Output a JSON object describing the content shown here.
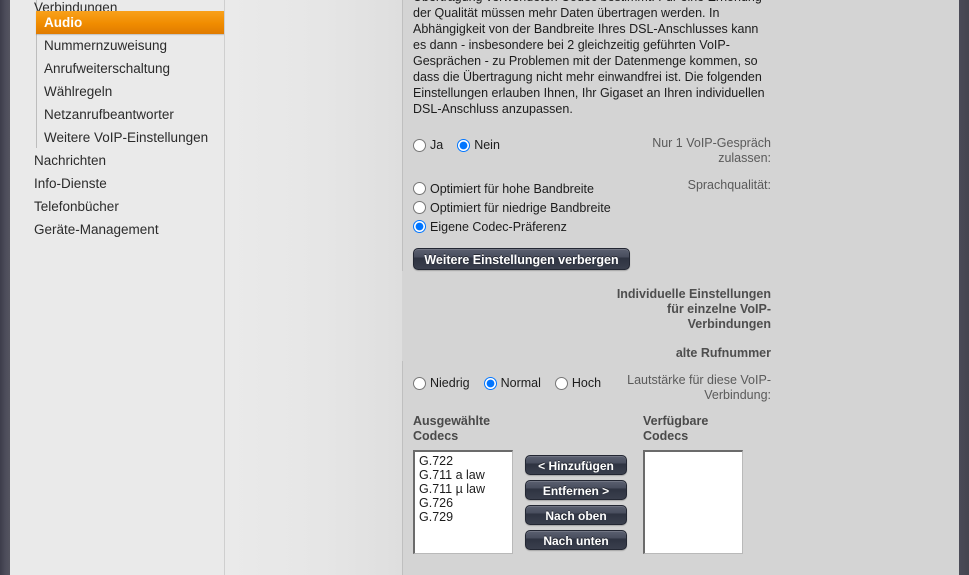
{
  "sidebar": {
    "items": [
      {
        "label": "Verbindungen",
        "level": 1,
        "state": "clipped"
      },
      {
        "label": "Audio",
        "level": 2,
        "state": "active"
      },
      {
        "label": "Nummernzuweisung",
        "level": 2,
        "state": "normal"
      },
      {
        "label": "Anrufweiterschaltung",
        "level": 2,
        "state": "normal"
      },
      {
        "label": "Wählregeln",
        "level": 2,
        "state": "normal"
      },
      {
        "label": "Netzanrufbeantworter",
        "level": 2,
        "state": "normal"
      },
      {
        "label": "Weitere VoIP-Einstellungen",
        "level": 2,
        "state": "normal"
      },
      {
        "label": "Nachrichten",
        "level": 1,
        "state": "normal"
      },
      {
        "label": "Info-Dienste",
        "level": 1,
        "state": "normal"
      },
      {
        "label": "Telefonbücher",
        "level": 1,
        "state": "normal"
      },
      {
        "label": "Geräte-Management",
        "level": 1,
        "state": "normal"
      }
    ]
  },
  "main": {
    "intro_paragraph": "Übertragung verwendeten Codec bestimmt. Für eine Erhöhung der Qualität müssen mehr Daten übertragen werden. In Abhängigkeit von der Bandbreite Ihres DSL-Anschlusses kann es dann - insbesondere bei 2 gleichzeitig geführten VoIP-Gesprächen - zu Problemen mit der Datenmenge kommen, so dass die Übertragung nicht mehr einwandfrei ist. Die folgenden Einstellungen erlauben Ihnen, Ihr Gigaset an Ihren individuellen DSL-Anschluss anzupassen.",
    "single_call": {
      "label_line1": "Nur 1 VoIP-Gespräch",
      "label_line2": "zulassen:",
      "options": [
        {
          "label": "Ja",
          "checked": false
        },
        {
          "label": "Nein",
          "checked": true
        }
      ]
    },
    "voice_quality": {
      "label": "Sprachqualität:",
      "options": [
        {
          "label": "Optimiert für hohe Bandbreite",
          "checked": false
        },
        {
          "label": "Optimiert für niedrige Bandbreite",
          "checked": false
        },
        {
          "label": "Eigene Codec-Präferenz",
          "checked": true
        }
      ],
      "toggle_button": "Weitere Einstellungen verbergen"
    },
    "individual_settings": {
      "label_line1": "Individuelle Einstellungen",
      "label_line2": "für einzelne VoIP-",
      "label_line3": "Verbindungen"
    },
    "old_number": {
      "label": "alte Rufnummer",
      "value": ""
    },
    "volume": {
      "label_line1": "Lautstärke für diese VoIP-",
      "label_line2": "Verbindung:",
      "options": [
        {
          "label": "Niedrig",
          "checked": false
        },
        {
          "label": "Normal",
          "checked": true
        },
        {
          "label": "Hoch",
          "checked": false
        }
      ]
    },
    "codecs": {
      "selected_heading_line1": "Ausgewählte",
      "selected_heading_line2": "Codecs",
      "available_heading_line1": "Verfügbare",
      "available_heading_line2": "Codecs",
      "selected_list": [
        "G.722",
        "G.711 a law",
        "G.711 µ law",
        "G.726",
        "G.729"
      ],
      "available_list": [],
      "buttons": [
        "< Hinzufügen",
        "Entfernen >",
        "Nach oben",
        "Nach unten"
      ]
    }
  },
  "colors": {
    "accent_orange": "#f08c00",
    "rail_dark": "#484856",
    "page_bg": "#d4d4d4",
    "panel_bg": "#eaeaea",
    "button_dark": "#3a3f4d"
  }
}
